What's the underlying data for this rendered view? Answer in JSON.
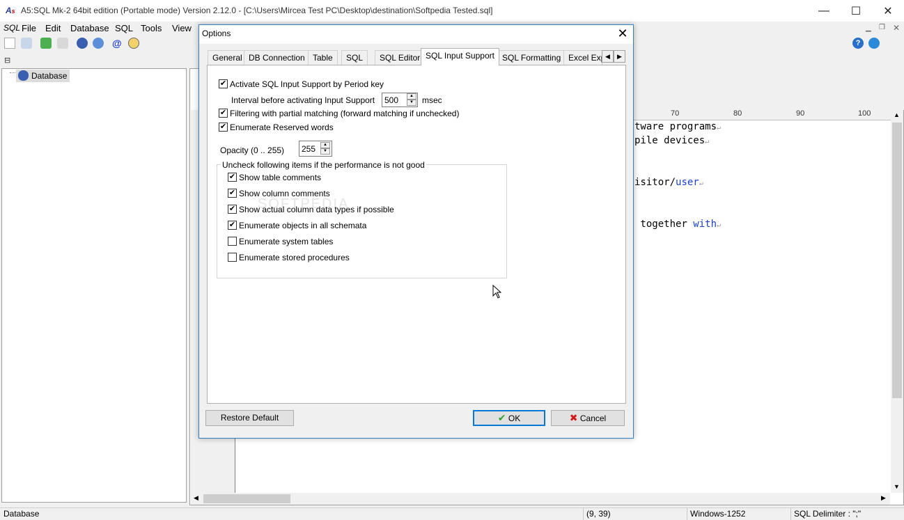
{
  "window": {
    "title": "A5:SQL Mk-2 64bit edition (Portable mode) Version 2.12.0 - [C:\\Users\\Mircea Test PC\\Desktop\\destination\\Softpedia Tested.sql]",
    "minimize_glyph": "—",
    "maximize_glyph": "☐",
    "close_glyph": "✕"
  },
  "menu": {
    "sql_logo": "SQL",
    "items": [
      "File",
      "Edit",
      "Database",
      "SQL",
      "Tools",
      "View"
    ]
  },
  "tree": {
    "root_label": "Database"
  },
  "editor": {
    "ruler": [
      "70",
      "80",
      "90",
      "100"
    ],
    "lines": [
      {
        "text": "tware programs",
        "kw": ""
      },
      {
        "text": "pile devices",
        "kw": ""
      },
      {
        "text": "isitor/",
        "kw": "user"
      },
      {
        "text": " together ",
        "kw": "with"
      }
    ],
    "return_glyph": "↵"
  },
  "statusbar": {
    "left": "Database",
    "position": "(9, 39)",
    "encoding": "Windows-1252",
    "delimiter": "SQL Delimiter : \";\""
  },
  "dialog": {
    "title": "Options",
    "tabs": [
      "General",
      "DB Connection",
      "Table",
      "SQL",
      "SQL Editor",
      "SQL Input Support",
      "SQL Formatting",
      "Excel Exp"
    ],
    "active_tab": "SQL Input Support",
    "activate_period": {
      "label": "Activate SQL Input Support by Period key",
      "checked": true
    },
    "interval": {
      "label": "Interval before activating Input Support",
      "value": "500",
      "unit": "msec"
    },
    "partial_matching": {
      "label": "Filtering with partial matching (forward matching if unchecked)",
      "checked": true
    },
    "reserved_words": {
      "label": "Enumerate Reserved words",
      "checked": true
    },
    "opacity": {
      "label": "Opacity (0 .. 255)",
      "value": "255"
    },
    "group_caption": "Uncheck following items if the performance is not good",
    "group_items": [
      {
        "label": "Show table comments",
        "checked": true
      },
      {
        "label": "Show column comments",
        "checked": true
      },
      {
        "label": "Show actual column data types if possible",
        "checked": true
      },
      {
        "label": "Enumerate objects in all schemata",
        "checked": true
      },
      {
        "label": "Enumerate system tables",
        "checked": false
      },
      {
        "label": "Enumerate stored procedures",
        "checked": false
      }
    ],
    "watermark": "SOFTPEDIA",
    "buttons": {
      "restore": "Restore Default",
      "ok": "OK",
      "cancel": "Cancel"
    }
  },
  "colors": {
    "accent": "#0078d7",
    "keyword": "#1a3fd1",
    "ok_check": "#2e9e2e",
    "cancel_x": "#d21a1a"
  }
}
